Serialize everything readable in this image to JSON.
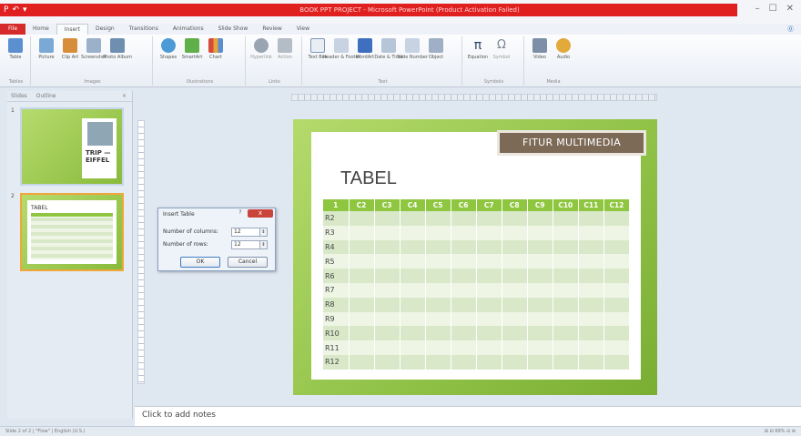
{
  "window": {
    "title": "BOOK PPT PROJECT - Microsoft PowerPoint (Product Activation Failed)",
    "quick_access": [
      "P",
      "↶",
      "▾"
    ]
  },
  "tabs": [
    "File",
    "Home",
    "Insert",
    "Design",
    "Transitions",
    "Animations",
    "Slide Show",
    "Review",
    "View"
  ],
  "active_tab": "Insert",
  "ribbon": {
    "tables": {
      "group": "Tables",
      "buttons": [
        "Table"
      ]
    },
    "images": {
      "group": "Images",
      "buttons": [
        "Picture",
        "Clip Art",
        "Screenshot",
        "Photo Album"
      ]
    },
    "illustrations": {
      "group": "Illustrations",
      "buttons": [
        "Shapes",
        "SmartArt",
        "Chart"
      ]
    },
    "links": {
      "group": "Links",
      "buttons": [
        "Hyperlink",
        "Action"
      ]
    },
    "text": {
      "group": "Text",
      "buttons": [
        "Text Box",
        "Header & Footer",
        "WordArt",
        "Date & Time",
        "Slide Number",
        "Object"
      ]
    },
    "symbols": {
      "group": "Symbols",
      "buttons": [
        "Equation",
        "Symbol"
      ]
    },
    "media": {
      "group": "Media",
      "buttons": [
        "Video",
        "Audio"
      ]
    }
  },
  "slides_pane": {
    "tabs": [
      "Slides",
      "Outline"
    ],
    "close": "×",
    "thumbs": [
      {
        "num": "1",
        "caption": "TRIP — EIFFEL"
      },
      {
        "num": "2",
        "caption": "TABEL"
      }
    ]
  },
  "slide": {
    "banner": "FITUR MULTIMEDIA",
    "title": "TABEL",
    "headers": [
      "1",
      "C2",
      "C3",
      "C4",
      "C5",
      "C6",
      "C7",
      "C8",
      "C9",
      "C10",
      "C11",
      "C12"
    ],
    "rows": [
      "R2",
      "R3",
      "R4",
      "R5",
      "R6",
      "R7",
      "R8",
      "R9",
      "R10",
      "R11",
      "R12"
    ]
  },
  "dialog": {
    "title": "Insert Table",
    "help": "?",
    "close": "x",
    "columns_label": "Number of columns:",
    "columns_value": "12",
    "rows_label": "Number of rows:",
    "rows_value": "12",
    "ok": "OK",
    "cancel": "Cancel"
  },
  "notes": {
    "placeholder": "Click to add notes"
  },
  "status": {
    "left": "Slide 2 of 2 | \"Flow\" | English (U.S.)",
    "right": "⊞ ⊟ 69% ⊖ ⊕"
  },
  "colors": {
    "title_bar": "#e01f1f",
    "accent_green": "#8ec63f",
    "banner": "#7c6a57"
  }
}
